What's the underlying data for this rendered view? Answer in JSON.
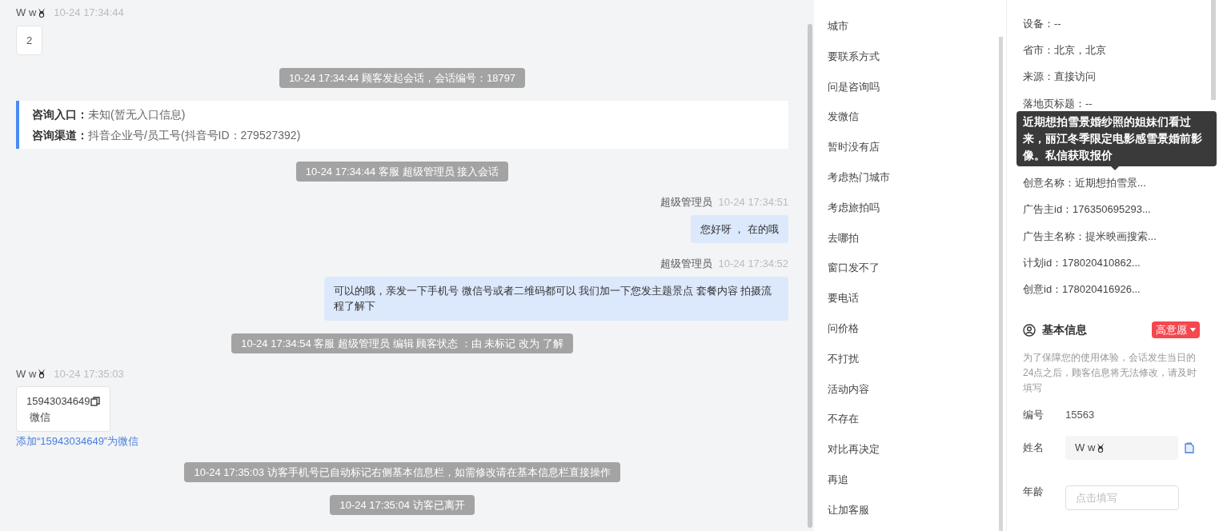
{
  "chat": {
    "messages": [
      {
        "kind": "visitor",
        "name": "W w",
        "time": "10-24 17:34:44",
        "text": "2"
      },
      {
        "kind": "system",
        "text": "10-24 17:34:44 顾客发起会话，会话编号：18797"
      },
      {
        "kind": "info",
        "rows": [
          {
            "label": "咨询入口：",
            "value": "未知(暂无入口信息)"
          },
          {
            "label": "咨询渠道：",
            "value": "抖音企业号/员工号(抖音号ID：279527392)"
          }
        ]
      },
      {
        "kind": "system",
        "text": "10-24 17:34:44 客服 超级管理员 接入会话"
      },
      {
        "kind": "agent",
        "name": "超级管理员",
        "time": "10-24 17:34:51",
        "text": "您好呀 ，  在的哦"
      },
      {
        "kind": "agent",
        "name": "超级管理员",
        "time": "10-24 17:34:52",
        "text": "可以的哦，亲发一下手机号 微信号或者二维码都可以 我们加一下您发主题景点 套餐内容 拍摄流程了解下"
      },
      {
        "kind": "system",
        "text": "10-24 17:34:54 客服 超级管理员 编辑 顾客状态 ：由 未标记 改为 了解"
      },
      {
        "kind": "contact",
        "name": "W w",
        "time": "10-24 17:35:03",
        "number": "15943034649",
        "type": "微信",
        "link": "添加“15943034649”为微信"
      },
      {
        "kind": "system",
        "text": "10-24 17:35:03 访客手机号已自动标记右侧基本信息栏，如需修改请在基本信息栏直接操作"
      },
      {
        "kind": "system",
        "text": "10-24 17:35:04 访客已离开"
      }
    ]
  },
  "quick_replies": [
    "城市",
    "要联系方式",
    "问是咨询吗",
    "发微信",
    "暂时没有店",
    "考虑热门城市",
    "考虑旅拍吗",
    "去哪拍",
    "窗口发不了",
    "要电话",
    "问价格",
    "不打扰",
    "活动内容",
    "不存在",
    "对比再决定",
    "再追",
    "让加客服"
  ],
  "details": {
    "rows": [
      "设备：--",
      "省市：北京，北京",
      "来源：直接访问",
      "落地页标题：--",
      null,
      null,
      "创意名称：近期想拍雪景...",
      "广告主id：176350695293...",
      "广告主名称：提米映画搜索...",
      "计划id：178020410862...",
      "创意id：178020416926..."
    ],
    "tooltip": "近期想拍雪景婚纱照的姐妹们看过来，丽江冬季限定电影感雪景婚前影像。私信获取报价"
  },
  "basic_info": {
    "title": "基本信息",
    "intent": "高意愿",
    "notice": "为了保障您的使用体验，会话发生当日的24点之后，顾客信息将无法修改，请及时填写",
    "fields": [
      {
        "kind": "text",
        "label": "编号",
        "value": "15563"
      },
      {
        "kind": "name",
        "label": "姓名",
        "value": "W w"
      },
      {
        "kind": "input",
        "label": "年龄",
        "placeholder": "点击填写"
      }
    ]
  }
}
